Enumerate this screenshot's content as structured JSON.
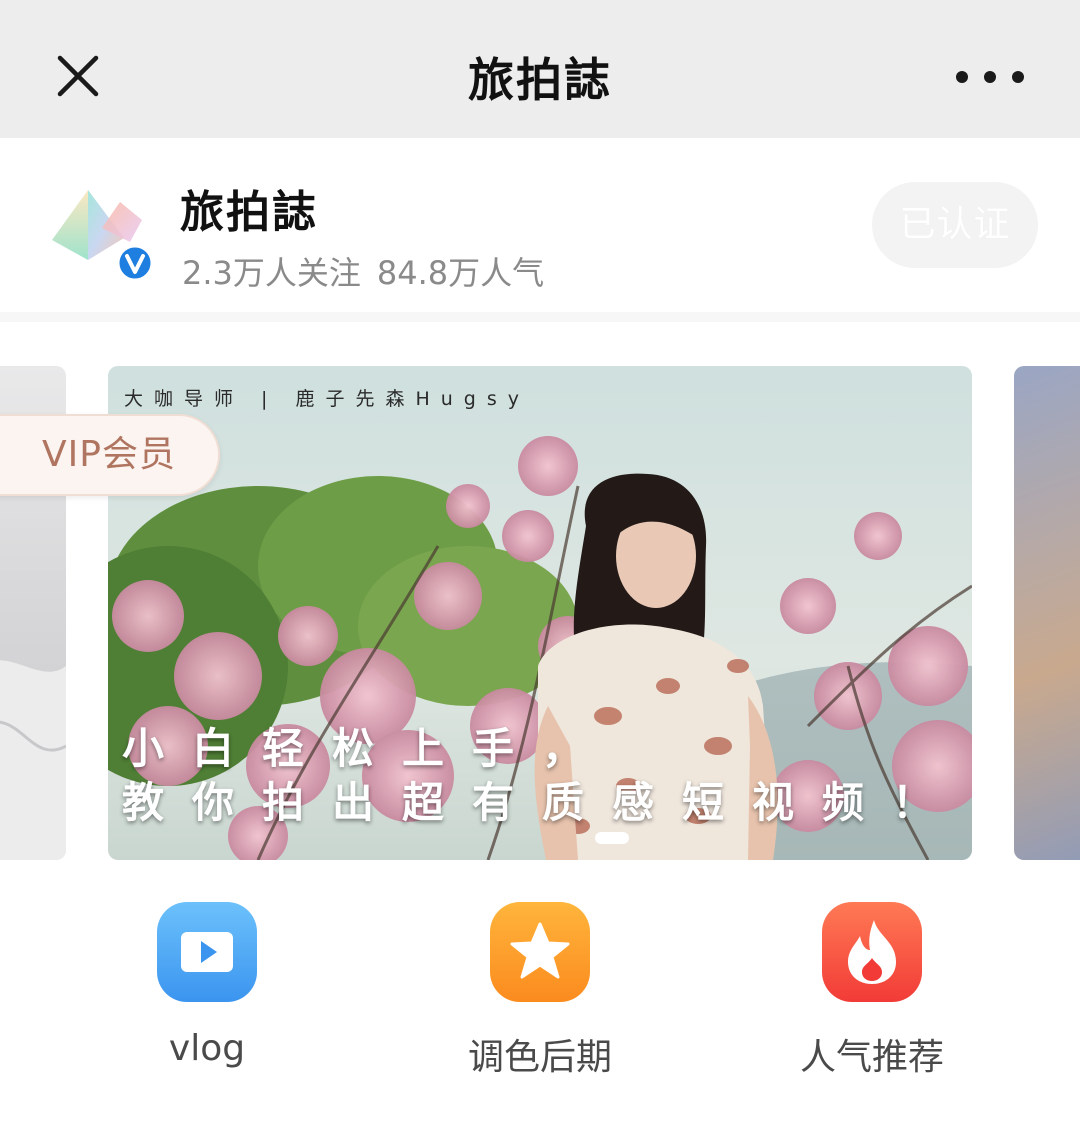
{
  "navbar": {
    "title": "旅拍誌",
    "close_icon": "close-icon",
    "more_icon": "more-dots-icon"
  },
  "profile": {
    "name": "旅拍誌",
    "followers": "2.3万人关注",
    "popularity": "84.8万人气",
    "verified_button": "已认证",
    "avatar_icon": "prism-logo",
    "badge_icon": "verified-v-icon"
  },
  "carousel": {
    "vip_tag": "VIP会员",
    "banner": {
      "credit": "大咖导师 | 鹿子先森Hugsy",
      "headline_line1": "小白轻松上手，",
      "headline_line2": "教你拍出超有质感短视频！"
    },
    "active_index": 1
  },
  "quick_nav": [
    {
      "label": "vlog",
      "icon": "play-icon",
      "color": "#3b95ef"
    },
    {
      "label": "调色后期",
      "icon": "star-icon",
      "color": "#fb8b1e"
    },
    {
      "label": "人气推荐",
      "icon": "flame-icon",
      "color": "#f23b37"
    }
  ]
}
